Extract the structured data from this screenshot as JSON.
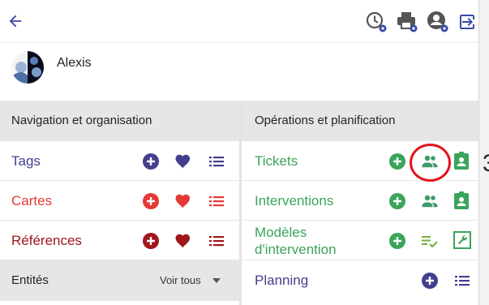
{
  "colors": {
    "accent_blue": "#3b4aa8",
    "purple": "#433f8e",
    "red": "#e53935",
    "dark_red": "#a0161c",
    "green": "#3aa45a",
    "teal_green": "#3d9a6a"
  },
  "user": {
    "name": "Alexis"
  },
  "topbar": {
    "icons": [
      "back-arrow-icon",
      "history-settings-icon",
      "print-settings-icon",
      "account-settings-icon",
      "logout-icon"
    ]
  },
  "left_section": {
    "header": "Navigation et organisation",
    "rows": [
      {
        "label": "Tags",
        "color": "#433f8e",
        "icons": [
          "add-circle-icon",
          "heart-icon",
          "list-icon"
        ]
      },
      {
        "label": "Cartes",
        "color": "#e53935",
        "icons": [
          "add-circle-icon",
          "heart-icon",
          "list-icon"
        ]
      },
      {
        "label": "Références",
        "color": "#a0161c",
        "icons": [
          "add-circle-icon",
          "heart-icon",
          "list-icon"
        ]
      }
    ],
    "entities": {
      "label": "Entités",
      "dropdown": "Voir tous"
    }
  },
  "right_section": {
    "header": "Opérations et planification",
    "rows": [
      {
        "label": "Tickets",
        "color": "#3aa45a",
        "icons": [
          "add-circle-icon",
          "people-icon",
          "badge-icon"
        ]
      },
      {
        "label": "Interventions",
        "color": "#3aa45a",
        "icons": [
          "add-circle-icon",
          "people-icon",
          "badge-icon"
        ]
      },
      {
        "label_line1": "Modèles",
        "label_line2": "d'intervention",
        "color": "#3aa45a",
        "icons": [
          "add-circle-icon",
          "checklist-icon",
          "wrench-icon"
        ]
      },
      {
        "label": "Planning",
        "color": "#433f8e",
        "icons": [
          "add-circle-icon",
          "list-icon"
        ]
      }
    ]
  }
}
